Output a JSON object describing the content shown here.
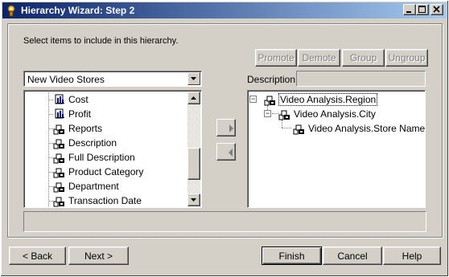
{
  "window": {
    "title": "Hierarchy Wizard: Step 2",
    "icon": "wizard-icon",
    "caption_buttons": [
      "minimize-icon",
      "maximize-icon",
      "close-icon"
    ]
  },
  "instruction": "Select items to include in this hierarchy.",
  "toolbar": {
    "promote": "Promote",
    "demote": "Demote",
    "group": "Group",
    "ungroup": "Ungroup"
  },
  "source": {
    "combo_value": "New Video Stores",
    "items": [
      {
        "label": "Cost",
        "icon": "measure-icon"
      },
      {
        "label": "Profit",
        "icon": "measure-icon"
      },
      {
        "label": "Reports",
        "icon": "dimension-icon"
      },
      {
        "label": "Description",
        "icon": "dimension-icon"
      },
      {
        "label": "Full Description",
        "icon": "dimension-icon"
      },
      {
        "label": "Product Category",
        "icon": "dimension-icon"
      },
      {
        "label": "Department",
        "icon": "dimension-icon"
      },
      {
        "label": "Transaction Date",
        "icon": "dimension-icon"
      }
    ]
  },
  "description": {
    "label": "Description:",
    "value": ""
  },
  "hierarchy": {
    "nodes": [
      {
        "label": "Video Analysis.Region",
        "level": 0,
        "expander": "−"
      },
      {
        "label": "Video Analysis.City",
        "level": 1,
        "expander": "−"
      },
      {
        "label": "Video Analysis.Store Name",
        "level": 2,
        "expander": ""
      }
    ]
  },
  "footer": {
    "back": "< Back",
    "next": "Next >",
    "finish": "Finish",
    "cancel": "Cancel",
    "help": "Help"
  }
}
